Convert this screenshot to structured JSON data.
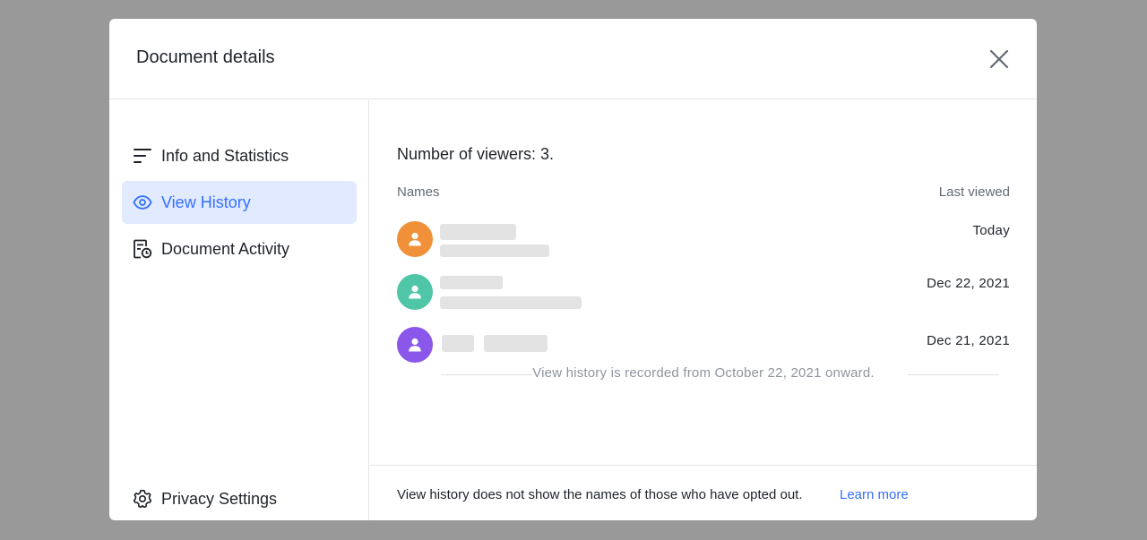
{
  "dialog": {
    "title": "Document details"
  },
  "sidebar": {
    "items": [
      {
        "label": "Info and Statistics",
        "icon": "list-lines-icon"
      },
      {
        "label": "View History",
        "icon": "eye-icon",
        "active": true
      },
      {
        "label": "Document Activity",
        "icon": "document-clock-icon"
      }
    ],
    "bottom_item": {
      "label": "Privacy Settings",
      "icon": "gear-icon"
    }
  },
  "view_history": {
    "viewers_count_text": "Number of viewers: 3.",
    "columns": {
      "names": "Names",
      "last_viewed": "Last viewed"
    },
    "viewers": [
      {
        "avatar_color": "#f0913a",
        "last_viewed": "Today"
      },
      {
        "avatar_color": "#4fc6a8",
        "last_viewed": "Dec 22, 2021"
      },
      {
        "avatar_color": "#8a57ea",
        "last_viewed": "Dec 21, 2021"
      }
    ],
    "record_note": "View history is recorded from October 22, 2021 onward."
  },
  "footer": {
    "text": "View history does not show the names of those who have opted out.",
    "learn_more": "Learn more"
  },
  "colors": {
    "accent": "#3370ff",
    "active_bg": "#e1eaff",
    "overlay": "#999999"
  }
}
